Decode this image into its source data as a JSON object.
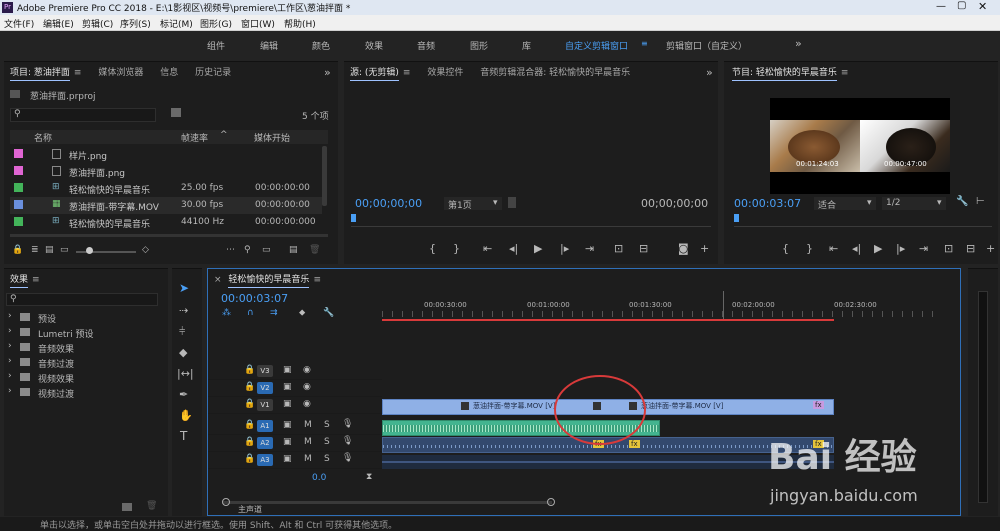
{
  "titlebar": {
    "app_icon": "Pr",
    "title": "Adobe Premiere Pro CC 2018 - E:\\1影视区\\视频号\\premiere\\工作区\\葱油拌面 *",
    "min_icon": "minimize-icon",
    "max_icon": "maximize-icon",
    "close_icon": "close-icon"
  },
  "menu": [
    "文件(F)",
    "编辑(E)",
    "剪辑(C)",
    "序列(S)",
    "标记(M)",
    "图形(G)",
    "窗口(W)",
    "帮助(H)"
  ],
  "workspaces": [
    "组件",
    "编辑",
    "颜色",
    "效果",
    "音频",
    "图形",
    "库",
    "自定义剪辑窗口",
    "剪辑窗口（自定义）"
  ],
  "workspace_active": "自定义剪辑窗口",
  "workspace_more": "»",
  "project": {
    "tabs": [
      "项目: 葱油拌面",
      "媒体浏览器",
      "信息",
      "历史记录"
    ],
    "tabs_more": "»",
    "file": "葱油拌面.prproj",
    "count": "5 个项",
    "cols": [
      "名称",
      "帧速率",
      "媒体开始"
    ],
    "rows": [
      {
        "color": "#e065d3",
        "name": "样片.png",
        "fps": "",
        "start": ""
      },
      {
        "color": "#e065d3",
        "name": "葱油拌面.png",
        "fps": "",
        "start": ""
      },
      {
        "color": "#43b45a",
        "name": "轻松愉快的早晨音乐",
        "fps": "25.00 fps",
        "start": "00:00:00:00"
      },
      {
        "color": "#6a8fdc",
        "name": "葱油拌面-带字幕.MOV",
        "fps": "30.00 fps",
        "start": "00:00:00:00"
      },
      {
        "color": "#43b45a",
        "name": "轻松愉快的早晨音乐",
        "fps": "44100 Hz",
        "start": "00:00:00:000"
      }
    ]
  },
  "source": {
    "tabs": [
      "源: (无剪辑)",
      "效果控件",
      "音频剪辑混合器: 轻松愉快的早晨音乐"
    ],
    "more": "»",
    "timecode_left": "00;00;00;00",
    "page": "第1页",
    "timecode_right": "00;00;00;00"
  },
  "program": {
    "title": "节目: 轻松愉快的早晨音乐",
    "timecode": "00:00:03:07",
    "fit": "适合",
    "ratio": "1/2",
    "tc1": "00:01:24:03",
    "tc2": "00:00:47:00",
    "thumb_colors": [
      "#a87b4a",
      "#3a2b1e",
      "#d6cfc4",
      "#6f5a44"
    ]
  },
  "effects": {
    "tab": "效果",
    "items": [
      "预设",
      "Lumetri 预设",
      "音频效果",
      "音频过渡",
      "视频效果",
      "视频过渡"
    ]
  },
  "timeline": {
    "close": "×",
    "name": "轻松愉快的早晨音乐",
    "timecode": "00:00:03:07",
    "ruler": [
      "00:00:30:00",
      "00:01:00:00",
      "00:01:30:00",
      "00:02:00:00",
      "00:02:30:00"
    ],
    "v_tracks": [
      "V3",
      "V2",
      "V1"
    ],
    "a_tracks": [
      "A1",
      "A2",
      "A3"
    ],
    "clip_label": "葱油拌面-带字幕.MOV [V]",
    "fx": "fx",
    "master": "主声道",
    "master_val": "0.0",
    "M": "M",
    "S": "S"
  },
  "status": "单击以选择，或单击空白处并拖动以进行框选。使用 Shift、Alt 和 Ctrl 可获得其他选项。",
  "watermark": {
    "text": "Bai 经验",
    "url": "jingyan.baidu.com"
  },
  "colors": {
    "accent": "#4a9ff5",
    "clip_video": "#8fb0e6",
    "clip_audio": "#43b48f",
    "ring": "#d83a3a",
    "playhead": "#d83a3a"
  }
}
